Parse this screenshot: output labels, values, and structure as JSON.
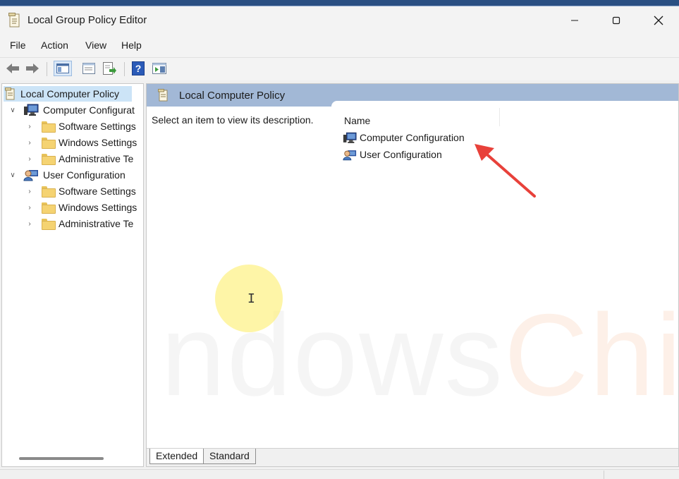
{
  "window": {
    "title": "Local Group Policy Editor"
  },
  "menu": [
    "File",
    "Action",
    "View",
    "Help"
  ],
  "tree": {
    "root": "Local Computer Policy",
    "computer": "Computer Configurat",
    "computer_children": [
      "Software Settings",
      "Windows Settings",
      "Administrative Te"
    ],
    "user": "User Configuration",
    "user_children": [
      "Software Settings",
      "Windows Settings",
      "Administrative Te"
    ]
  },
  "right": {
    "header": "Local Computer Policy",
    "description": "Select an item to view its description.",
    "column_name": "Name",
    "items": [
      "Computer Configuration",
      "User Configuration"
    ]
  },
  "tabs": [
    "Extended",
    "Standard"
  ],
  "watermark": {
    "part1": "ndows",
    "part2": "Chimp"
  },
  "colors": {
    "annotation_arrow": "#e8413a",
    "header_band": "#a2b8d6",
    "selection": "#cce4f7"
  }
}
